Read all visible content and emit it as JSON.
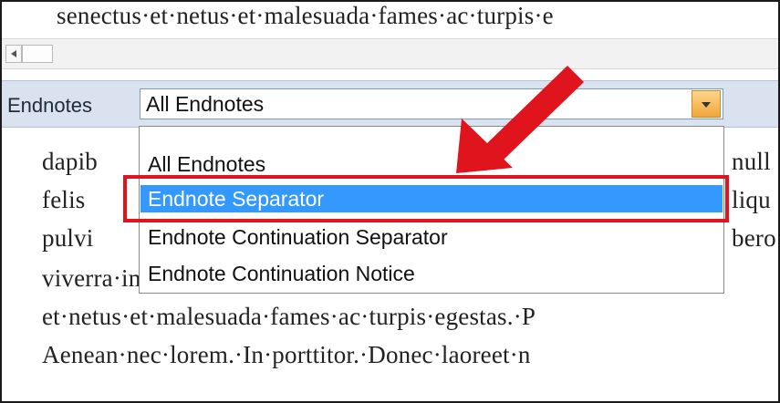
{
  "document": {
    "lines": [
      "senectus·et·netus·et·malesuada·fames·ac·turpis·e",
      "dapib",
      "null",
      "felis",
      "liqu",
      "pulvi",
      "bero",
      "viverra·imperdiet·enim.·Fusce·est.·Vivamus·a·te",
      "et·netus·et·malesuada·fames·ac·turpis·egestas.·P",
      "Aenean·nec·lorem.·In·porttitor.·Donec·laoreet·n"
    ]
  },
  "notes_bar": {
    "label": "Endnotes",
    "selected_value": "All Endnotes"
  },
  "dropdown": {
    "items": [
      "All Endnotes",
      "Endnote Separator",
      "Endnote Continuation Separator",
      "Endnote Continuation Notice"
    ],
    "selected_index": 1
  },
  "annotation": {
    "arrow_color": "#e0141d",
    "box_color": "#e0141d",
    "highlight_color": "#3399ff"
  }
}
